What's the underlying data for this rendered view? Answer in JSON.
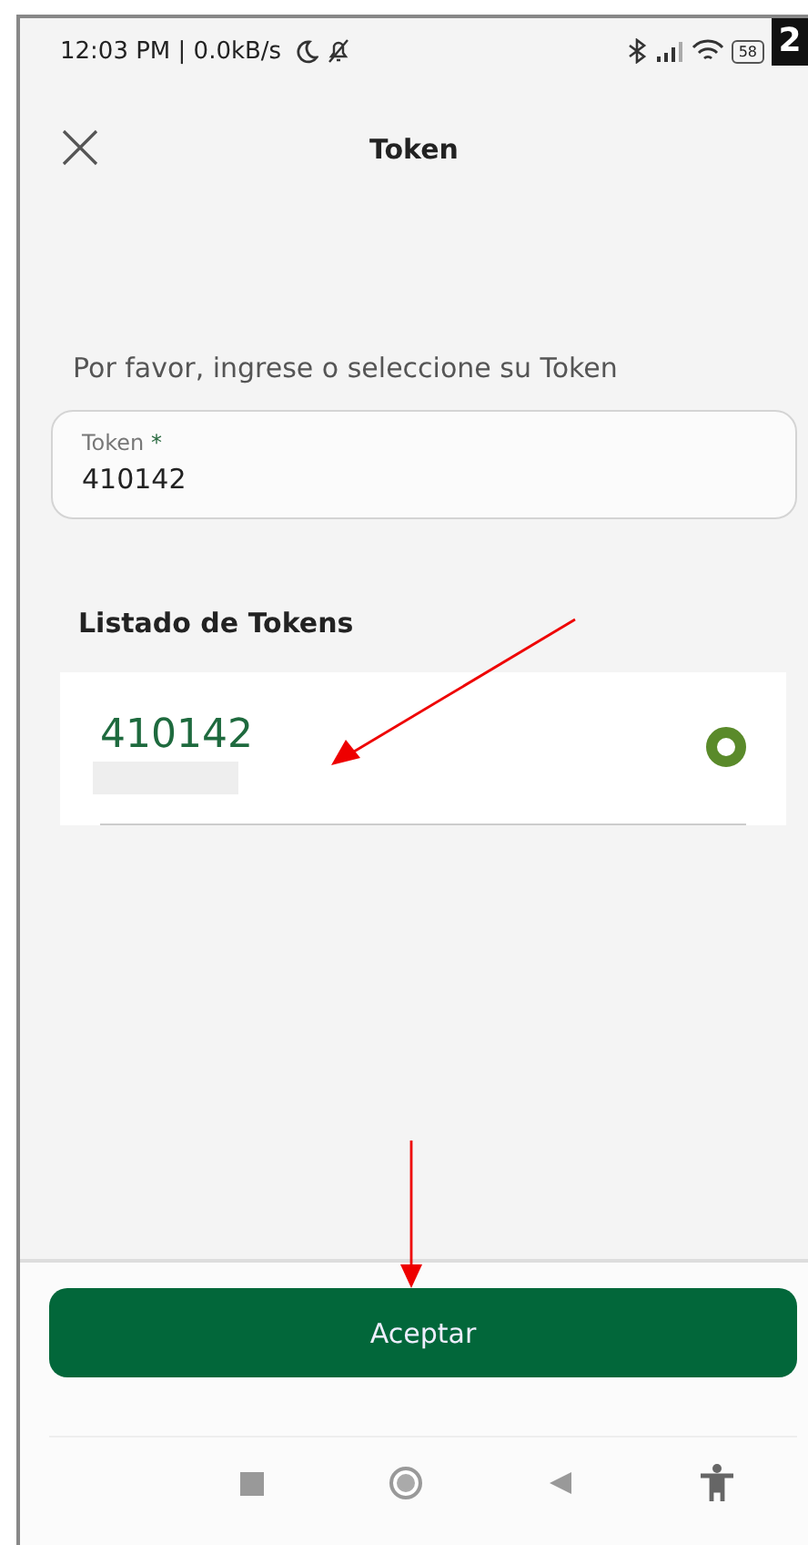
{
  "status_bar": {
    "time": "12:03 PM | 0.0kB/s",
    "battery": "58"
  },
  "step_badge": "2",
  "header": {
    "title": "Token"
  },
  "prompt": "Por favor, ingrese o seleccione su Token",
  "token_field": {
    "label": "Token",
    "required_mark": "*",
    "value": "410142"
  },
  "list": {
    "heading": "Listado de Tokens",
    "items": [
      {
        "token": "410142",
        "selected": true
      }
    ]
  },
  "primary_button": "Aceptar"
}
